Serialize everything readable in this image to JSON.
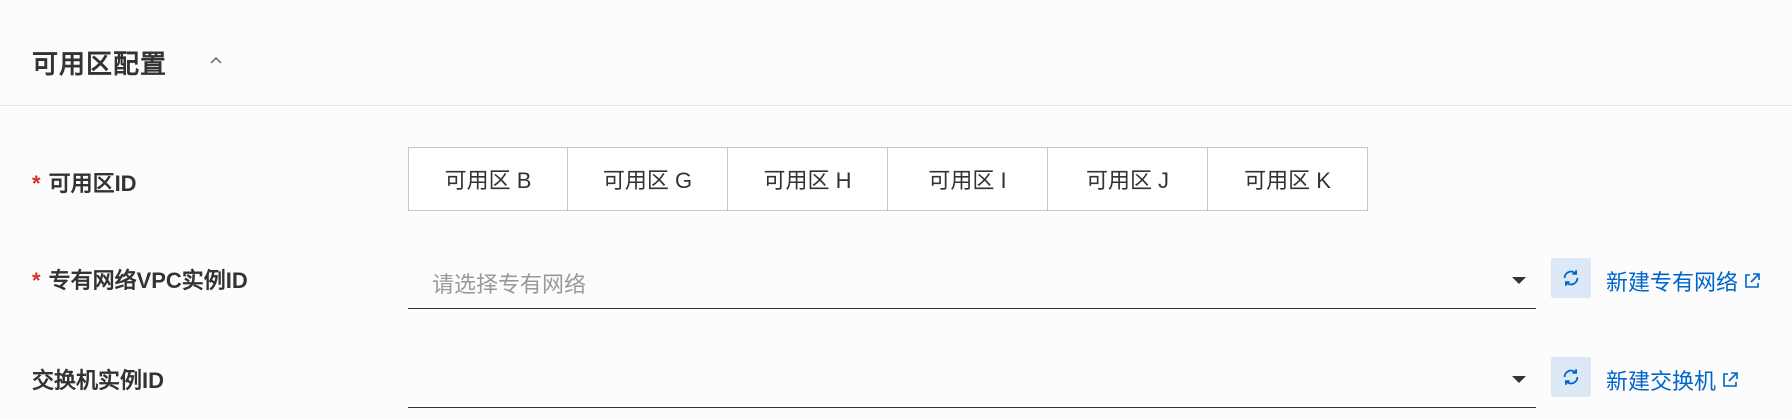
{
  "section": {
    "title": "可用区配置"
  },
  "zone": {
    "label": "可用区ID",
    "required": "*",
    "options": [
      "可用区 B",
      "可用区 G",
      "可用区 H",
      "可用区 I",
      "可用区 J",
      "可用区 K"
    ]
  },
  "vpc": {
    "label": "专有网络VPC实例ID",
    "required": "*",
    "placeholder": "请选择专有网络",
    "create_link": "新建专有网络"
  },
  "vswitch": {
    "label": "交换机实例ID",
    "placeholder": "",
    "create_link": "新建交换机"
  },
  "colors": {
    "required": "#d93026",
    "link": "#0064c8",
    "refresh_bg": "#dce8f6"
  },
  "icons": [
    "chevron-up-icon",
    "caret-down-icon",
    "refresh-icon",
    "external-link-icon"
  ]
}
